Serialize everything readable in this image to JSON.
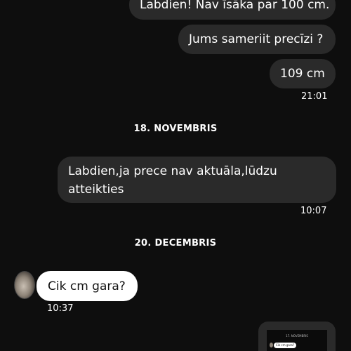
{
  "messages": {
    "m1": "Labdien! Nav īsāka par 100 cm.",
    "m2": "Jums sameriit precīzi ?",
    "m3": "109 cm",
    "t1": "21:01",
    "d1": "18. NOVEMBRIS",
    "m4": "Labdien,ja prece nav aktuāla,lūdzu atteikties",
    "t2": "10:07",
    "d2": "20. DECEMBRIS",
    "m5": "Cik cm gara?",
    "t3": "10:37"
  },
  "thumbnail": {
    "date": "17. NOVEMBRIS",
    "bubble": "Cik cm gara?"
  },
  "colors": {
    "background": "#0e0e0e",
    "outgoing_bubble": "#2a2a2a",
    "incoming_bubble": "#ffffff"
  }
}
